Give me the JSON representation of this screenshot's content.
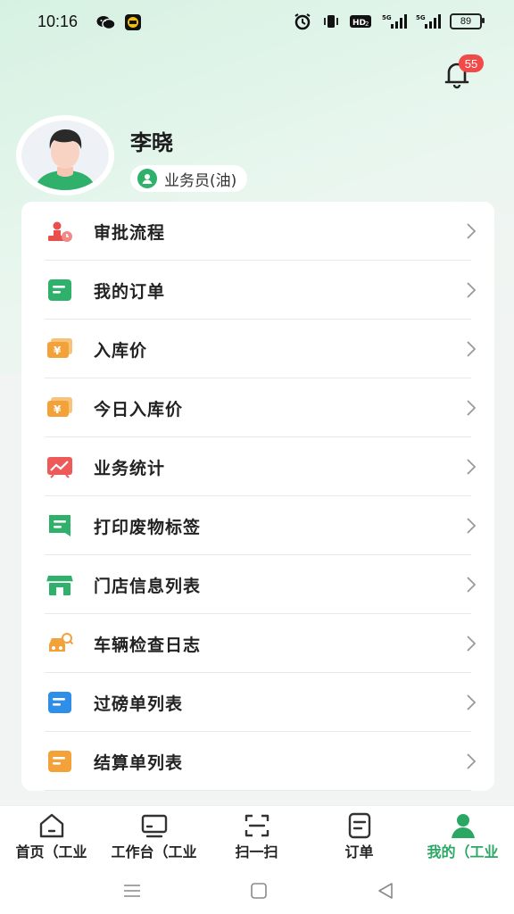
{
  "status_bar": {
    "time": "10:16",
    "battery": "89",
    "signal1": "5G",
    "signal2": "5G",
    "hd": "HD2"
  },
  "notifications": {
    "badge_count": "55"
  },
  "profile": {
    "name": "李晓",
    "role": "业务员(油)"
  },
  "menu": {
    "items": [
      {
        "label": "审批流程",
        "icon": "approval-stamp-icon",
        "color": "#e8504e"
      },
      {
        "label": "我的订单",
        "icon": "order-list-icon",
        "color": "#2fb16b"
      },
      {
        "label": "入库价",
        "icon": "inbound-price-icon",
        "color": "#f3a23a"
      },
      {
        "label": "今日入库价",
        "icon": "today-inbound-price-icon",
        "color": "#f3a23a"
      },
      {
        "label": "业务统计",
        "icon": "chart-icon",
        "color": "#ee5a5a"
      },
      {
        "label": "打印废物标签",
        "icon": "print-label-icon",
        "color": "#2fb16b"
      },
      {
        "label": "门店信息列表",
        "icon": "store-icon",
        "color": "#2fb16b"
      },
      {
        "label": "车辆检查日志",
        "icon": "car-inspect-icon",
        "color": "#f3a23a"
      },
      {
        "label": "过磅单列表",
        "icon": "weigh-list-icon",
        "color": "#2f8ee8"
      },
      {
        "label": "结算单列表",
        "icon": "settlement-list-icon",
        "color": "#f3a23a"
      }
    ]
  },
  "tabbar": {
    "tabs": [
      {
        "label": "首页（工业",
        "icon": "home-icon"
      },
      {
        "label": "工作台（工业",
        "icon": "monitor-icon"
      },
      {
        "label": "扫一扫",
        "icon": "scan-icon"
      },
      {
        "label": "订单",
        "icon": "order-icon"
      },
      {
        "label": "我的（工业",
        "icon": "profile-icon"
      }
    ],
    "active_color": "#2aa863"
  }
}
